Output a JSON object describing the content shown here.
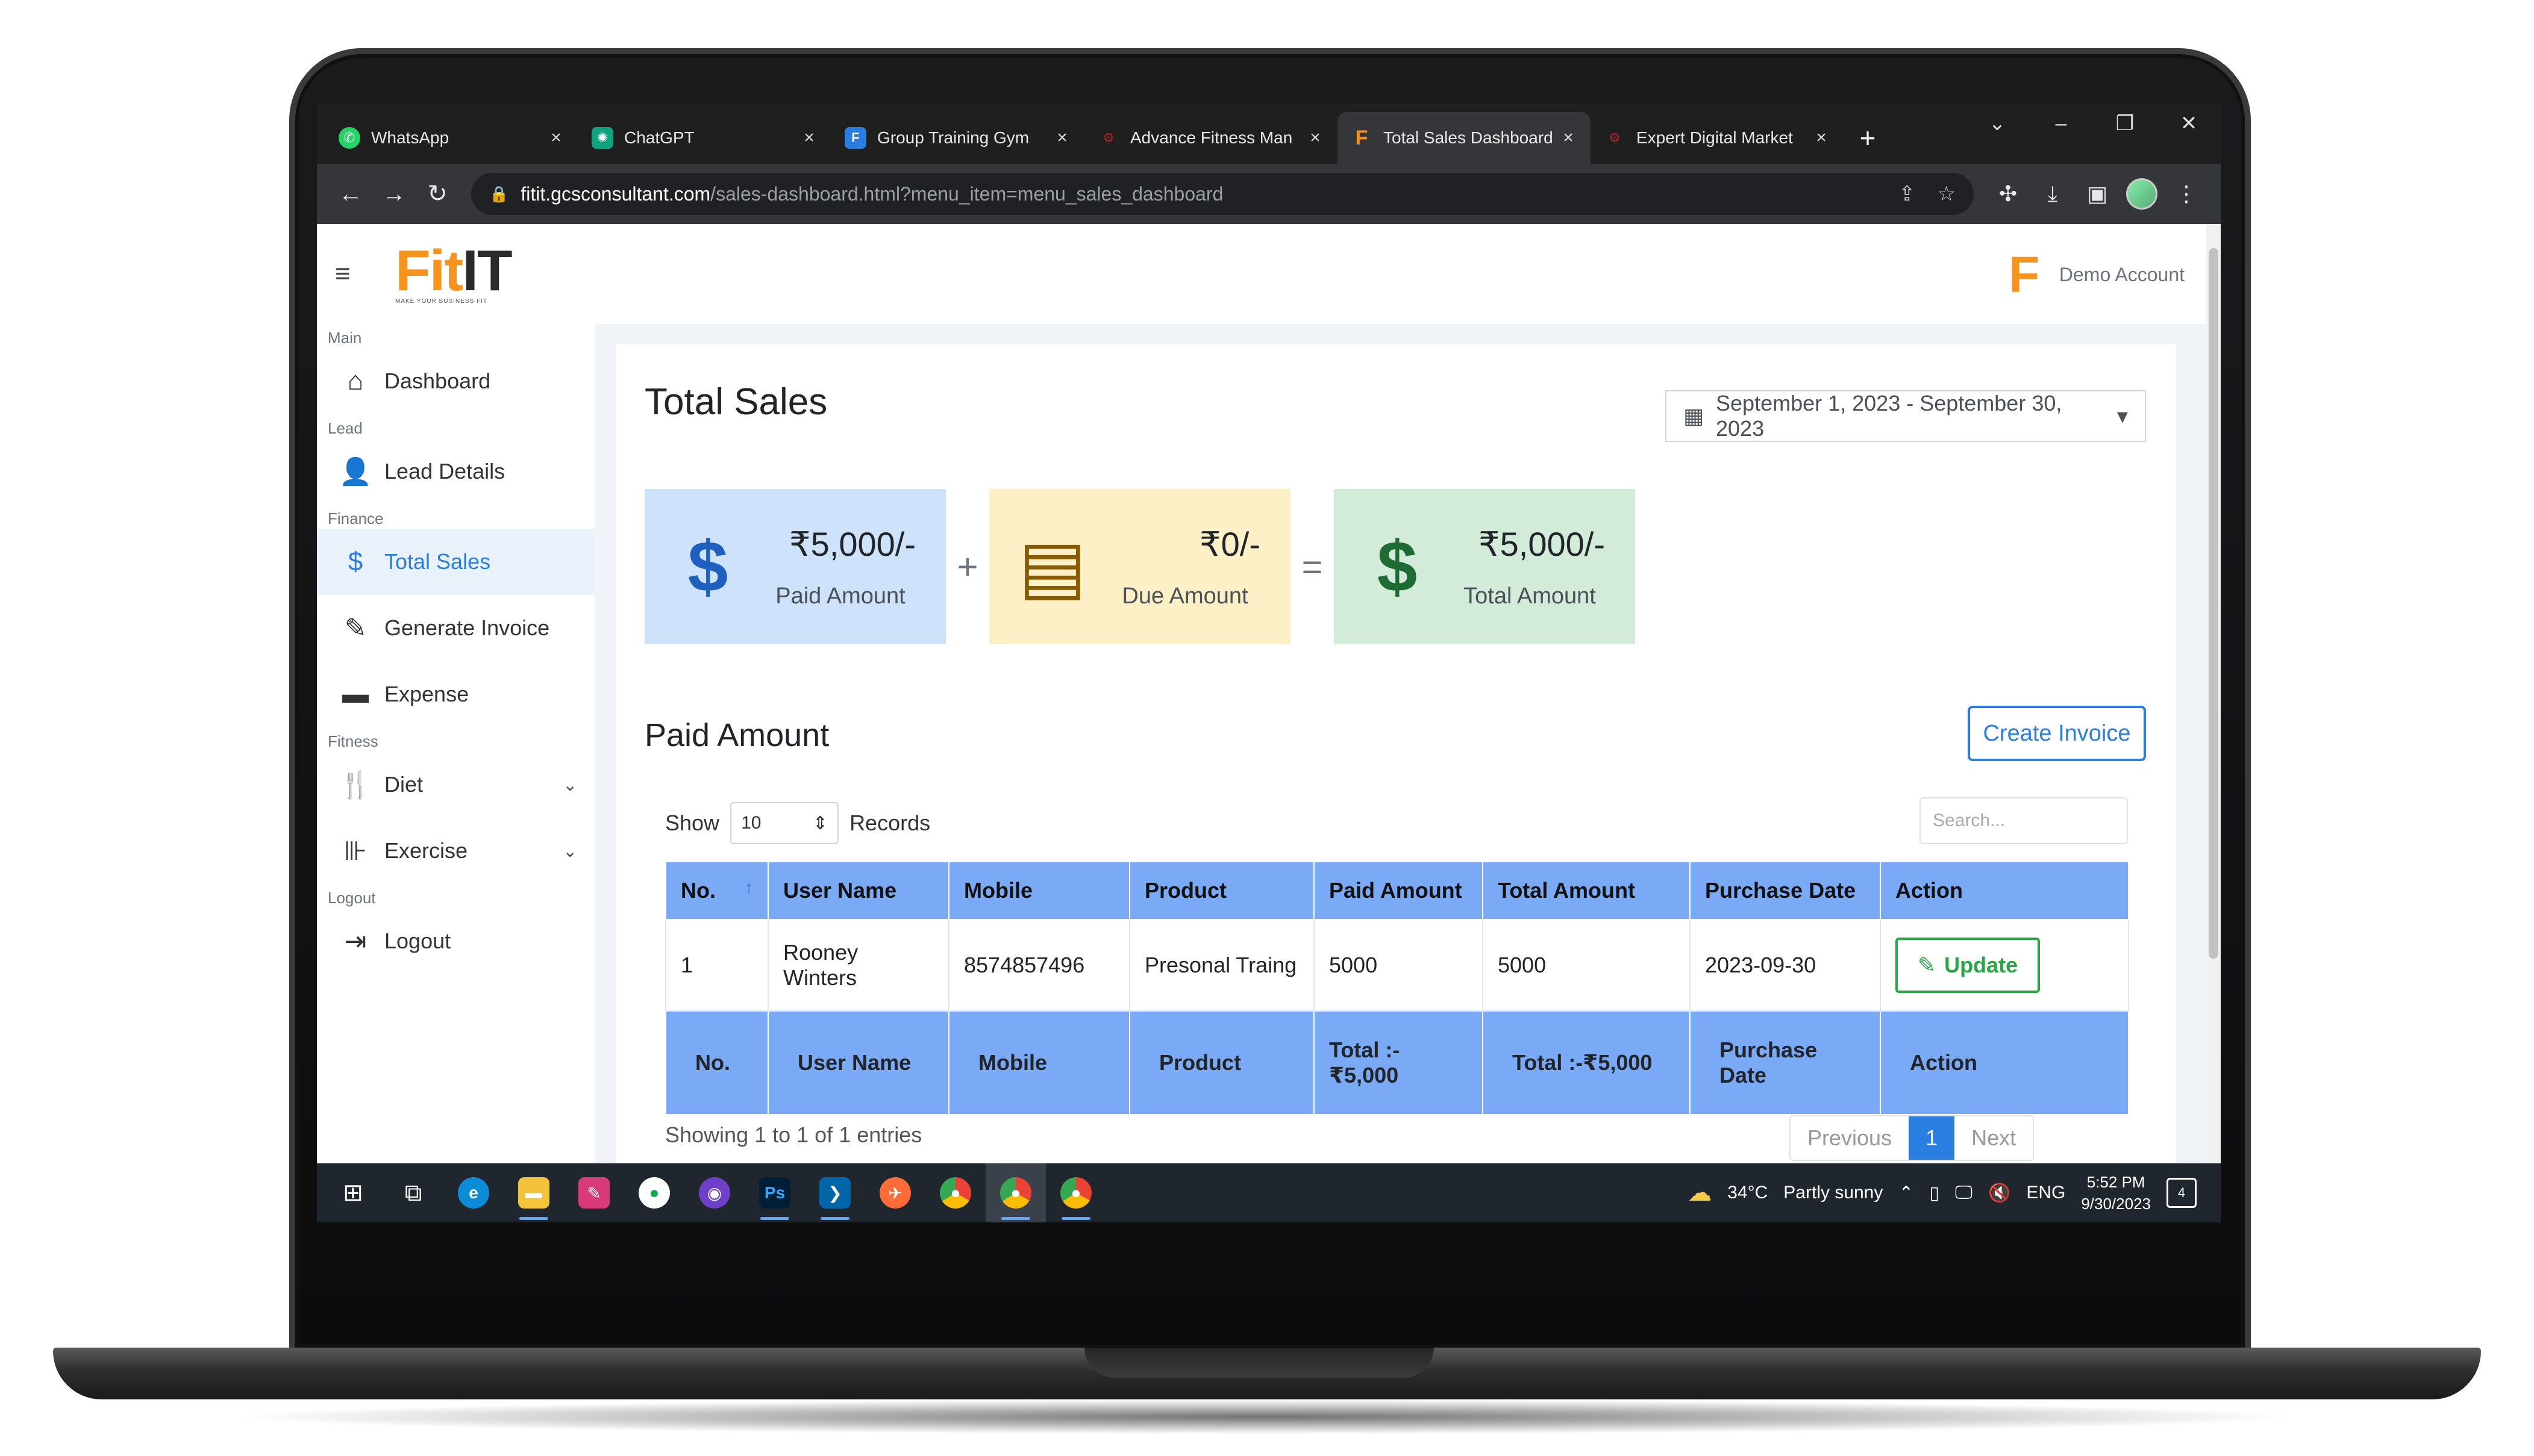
{
  "browser": {
    "tabs": [
      {
        "label": "WhatsApp",
        "icon": "whatsapp-icon",
        "color": "#25d366"
      },
      {
        "label": "ChatGPT",
        "icon": "chatgpt-icon",
        "color": "#10a37f"
      },
      {
        "label": "Group Training Gym",
        "icon": "fitit-f-icon",
        "color": "#2a7de1"
      },
      {
        "label": "Advance Fitness Man",
        "icon": "gcs-icon",
        "color": "#b22222"
      },
      {
        "label": "Total Sales Dashboard",
        "icon": "fitit-orange-icon",
        "color": "#f7941d"
      },
      {
        "label": "Expert Digital Market",
        "icon": "gcs-icon",
        "color": "#b22222"
      }
    ],
    "url_host": "fitit.gcsconsultant.com",
    "url_path": "/sales-dashboard.html?menu_item=menu_sales_dashboard"
  },
  "header": {
    "logo_fit": "Fit",
    "logo_it": "IT",
    "logo_tagline": "MAKE YOUR BUSINESS FIT",
    "account_name": "Demo Account"
  },
  "sidebar": {
    "sections": {
      "main": "Main",
      "lead": "Lead",
      "finance": "Finance",
      "fitness": "Fitness",
      "logout": "Logout"
    },
    "items": {
      "dashboard": "Dashboard",
      "lead_details": "Lead Details",
      "total_sales": "Total Sales",
      "generate_invoice": "Generate Invoice",
      "expense": "Expense",
      "diet": "Diet",
      "exercise": "Exercise",
      "logout": "Logout"
    }
  },
  "main": {
    "title": "Total Sales",
    "date_range": "September 1, 2023 - September 30, 2023",
    "summary": {
      "paid": {
        "amount": "₹5,000/-",
        "label": "Paid Amount",
        "bg": "#cfe2fb",
        "icon_color": "#1f5fbf"
      },
      "due": {
        "amount": "₹0/-",
        "label": "Due Amount",
        "bg": "#fdf0c6",
        "icon_color": "#8a5a00"
      },
      "total": {
        "amount": "₹5,000/-",
        "label": "Total Amount",
        "bg": "#d3ecd9",
        "icon_color": "#1e6b34"
      },
      "plus": "+",
      "equals": "="
    },
    "section_title": "Paid Amount",
    "create_invoice": "Create Invoice",
    "show_label": "Show",
    "page_size": "10",
    "records_label": "Records",
    "search_placeholder": "Search...",
    "table": {
      "headers": [
        "No.",
        "User Name",
        "Mobile",
        "Product",
        "Paid Amount",
        "Total Amount",
        "Purchase Date",
        "Action"
      ],
      "rows": [
        {
          "no": "1",
          "user": "Rooney Winters",
          "mobile": "8574857496",
          "product": "Presonal Traing",
          "paid": "5000",
          "total": "5000",
          "date": "2023-09-30",
          "action": "Update"
        }
      ],
      "footer": [
        "No.",
        "User Name",
        "Mobile",
        "Product",
        "Total :-₹5,000",
        "Total :-₹5,000",
        "Purchase Date",
        "Action"
      ]
    },
    "showing": "Showing 1 to 1 of 1 entries",
    "pager": {
      "previous": "Previous",
      "current": "1",
      "next": "Next"
    }
  },
  "taskbar": {
    "weather": "34°C",
    "weather_desc": "Partly sunny",
    "lang": "ENG",
    "time": "5:52 PM",
    "date": "9/30/2023",
    "notifications": "4"
  }
}
